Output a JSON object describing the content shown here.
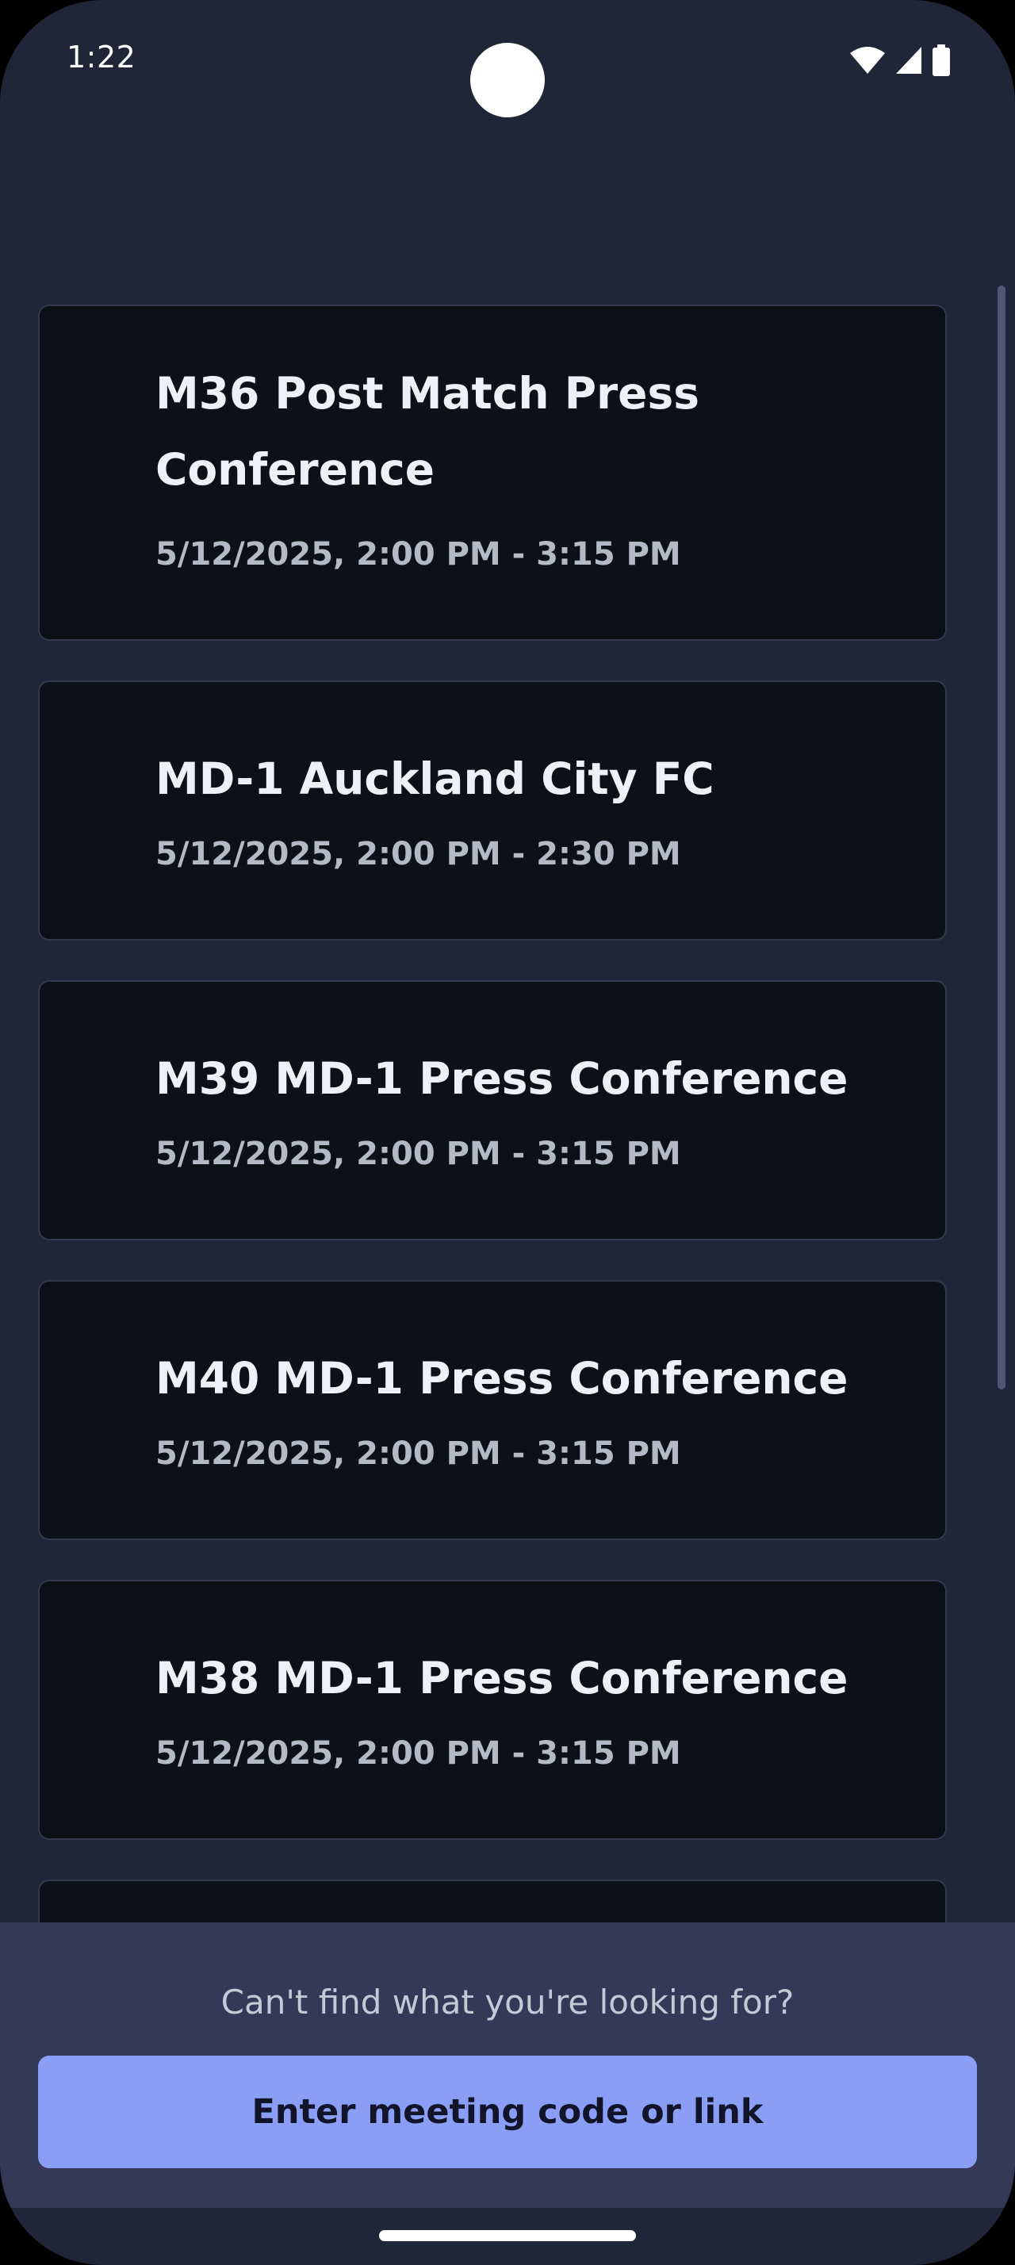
{
  "status_bar": {
    "time": "1:22",
    "icons": [
      "wifi-icon",
      "cellular-signal-icon",
      "battery-icon"
    ]
  },
  "meetings": [
    {
      "title": "M36 Post Match Press Conference",
      "time": "5/12/2025, 2:00 PM - 3:15 PM"
    },
    {
      "title": "MD-1 Auckland City FC",
      "time": "5/12/2025, 2:00 PM - 2:30 PM"
    },
    {
      "title": "M39 MD-1 Press Conference",
      "time": "5/12/2025, 2:00 PM - 3:15 PM"
    },
    {
      "title": "M40 MD-1 Press Conference",
      "time": "5/12/2025, 2:00 PM - 3:15 PM"
    },
    {
      "title": "M38 MD-1 Press Conference",
      "time": "5/12/2025, 2:00 PM - 3:15 PM"
    }
  ],
  "footer": {
    "prompt": "Can't find what you're looking for?",
    "button_label": "Enter meeting code or link"
  },
  "colors": {
    "background": "#212538",
    "card": "#0d1018",
    "panel": "#343957",
    "accent": "#8b9ef5"
  }
}
